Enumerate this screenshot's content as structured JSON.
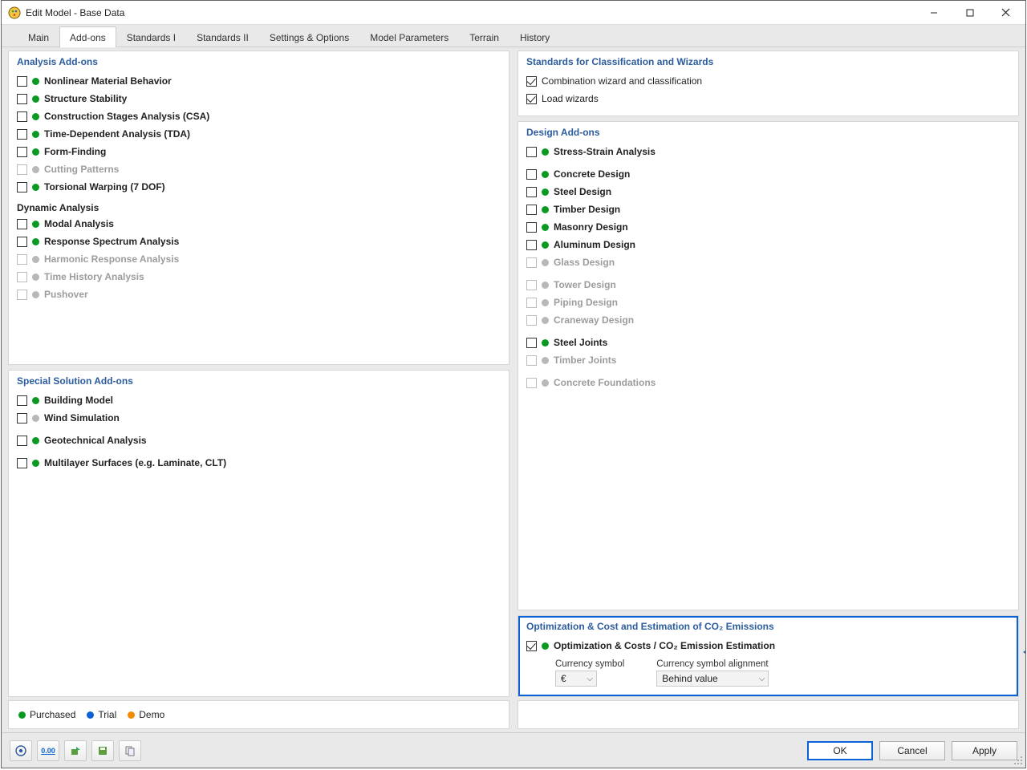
{
  "window": {
    "title": "Edit Model - Base Data"
  },
  "tabs": [
    "Main",
    "Add-ons",
    "Standards I",
    "Standards II",
    "Settings & Options",
    "Model Parameters",
    "Terrain",
    "History"
  ],
  "active_tab": 1,
  "panels": {
    "analysis": {
      "title": "Analysis Add-ons",
      "sub_dynamic": "Dynamic Analysis",
      "items": [
        {
          "label": "Nonlinear Material Behavior",
          "status": "green",
          "checked": false
        },
        {
          "label": "Structure Stability",
          "status": "green",
          "checked": false
        },
        {
          "label": "Construction Stages Analysis (CSA)",
          "status": "green",
          "checked": false
        },
        {
          "label": "Time-Dependent Analysis (TDA)",
          "status": "green",
          "checked": false
        },
        {
          "label": "Form-Finding",
          "status": "green",
          "checked": false
        },
        {
          "label": "Cutting Patterns",
          "status": "grey",
          "checked": false,
          "disabled": true
        },
        {
          "label": "Torsional Warping (7 DOF)",
          "status": "green",
          "checked": false
        }
      ],
      "dynamic_items": [
        {
          "label": "Modal Analysis",
          "status": "green",
          "checked": false
        },
        {
          "label": "Response Spectrum Analysis",
          "status": "green",
          "checked": false
        },
        {
          "label": "Harmonic Response Analysis",
          "status": "grey",
          "checked": false,
          "disabled": true
        },
        {
          "label": "Time History Analysis",
          "status": "grey",
          "checked": false,
          "disabled": true
        },
        {
          "label": "Pushover",
          "status": "grey",
          "checked": false,
          "disabled": true
        }
      ]
    },
    "special": {
      "title": "Special Solution Add-ons",
      "items": [
        {
          "label": "Building Model",
          "status": "green",
          "checked": false
        },
        {
          "label": "Wind Simulation",
          "status": "grey",
          "checked": false
        }
      ],
      "items2": [
        {
          "label": "Geotechnical Analysis",
          "status": "green",
          "checked": false
        }
      ],
      "items3": [
        {
          "label": "Multilayer Surfaces (e.g. Laminate, CLT)",
          "status": "green",
          "checked": false
        }
      ]
    },
    "standards": {
      "title": "Standards for Classification and Wizards",
      "items": [
        {
          "label": "Combination wizard and classification",
          "checked": true
        },
        {
          "label": "Load wizards",
          "checked": true
        }
      ]
    },
    "design": {
      "title": "Design Add-ons",
      "g1": [
        {
          "label": "Stress-Strain Analysis",
          "status": "green",
          "checked": false
        }
      ],
      "g2": [
        {
          "label": "Concrete Design",
          "status": "green",
          "checked": false
        },
        {
          "label": "Steel Design",
          "status": "green",
          "checked": false
        },
        {
          "label": "Timber Design",
          "status": "green",
          "checked": false
        },
        {
          "label": "Masonry Design",
          "status": "green",
          "checked": false
        },
        {
          "label": "Aluminum Design",
          "status": "green",
          "checked": false
        },
        {
          "label": "Glass Design",
          "status": "grey",
          "checked": false,
          "disabled": true
        }
      ],
      "g3": [
        {
          "label": "Tower Design",
          "status": "grey",
          "checked": false,
          "disabled": true
        },
        {
          "label": "Piping Design",
          "status": "grey",
          "checked": false,
          "disabled": true
        },
        {
          "label": "Craneway Design",
          "status": "grey",
          "checked": false,
          "disabled": true
        }
      ],
      "g4": [
        {
          "label": "Steel Joints",
          "status": "green",
          "checked": false
        },
        {
          "label": "Timber Joints",
          "status": "grey",
          "checked": false,
          "disabled": true
        }
      ],
      "g5": [
        {
          "label": "Concrete Foundations",
          "status": "grey",
          "checked": false,
          "disabled": true
        }
      ]
    },
    "optim": {
      "title": "Optimization & Cost and Estimation of CO₂ Emissions",
      "item": {
        "label": "Optimization & Costs / CO₂ Emission Estimation",
        "status": "green",
        "checked": true
      },
      "currency_label": "Currency symbol",
      "currency_value": "€",
      "align_label": "Currency symbol alignment",
      "align_value": "Behind value"
    }
  },
  "legend": {
    "purchased": "Purchased",
    "trial": "Trial",
    "demo": "Demo"
  },
  "buttons": {
    "ok": "OK",
    "cancel": "Cancel",
    "apply": "Apply"
  }
}
